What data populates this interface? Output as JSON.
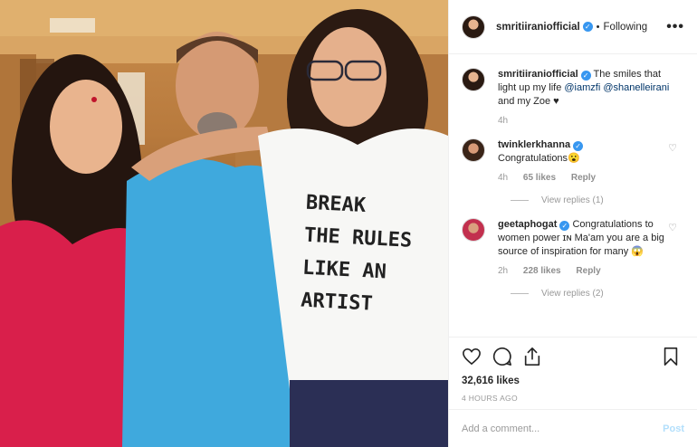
{
  "header": {
    "username": "smritiiraniofficial",
    "verified_icon": "verified-badge-icon",
    "separator": "•",
    "follow_status": "Following",
    "more_icon": "more-options-icon",
    "more_label": "•••"
  },
  "caption": {
    "username": "smritiiraniofficial",
    "text_1": "The smiles that light up my life",
    "mention_1": "@iamzfi",
    "mention_2": "@shanelleirani",
    "text_2": "and my Zoe",
    "emoji": "♥",
    "time": "4h"
  },
  "comments": [
    {
      "username": "twinklerkhanna",
      "text": "Congratulations😮",
      "time": "4h",
      "likes": "65 likes",
      "reply": "Reply",
      "view_replies": "View replies (1)"
    },
    {
      "username": "geetaphogat",
      "text": "Congratulations to women power ɪɴ Ma'am you are a big source of inspiration for many 😱",
      "time": "2h",
      "likes": "228 likes",
      "reply": "Reply",
      "view_replies": "View replies (2)"
    }
  ],
  "actions": {
    "like_icon": "heart-icon",
    "comment_icon": "comment-icon",
    "share_icon": "share-icon",
    "save_icon": "bookmark-icon",
    "likes_count": "32,616 likes",
    "posted_time": "4 HOURS AGO"
  },
  "comment_box": {
    "placeholder": "Add a comment...",
    "post_label": "Post"
  },
  "photo": {
    "shirt_text": [
      "BREAK",
      "THE RULES",
      "LIKE AN",
      "ARTIST"
    ]
  },
  "colors": {
    "verified": "#3897f0",
    "mention": "#003569",
    "post_disabled": "#b2dffc"
  }
}
